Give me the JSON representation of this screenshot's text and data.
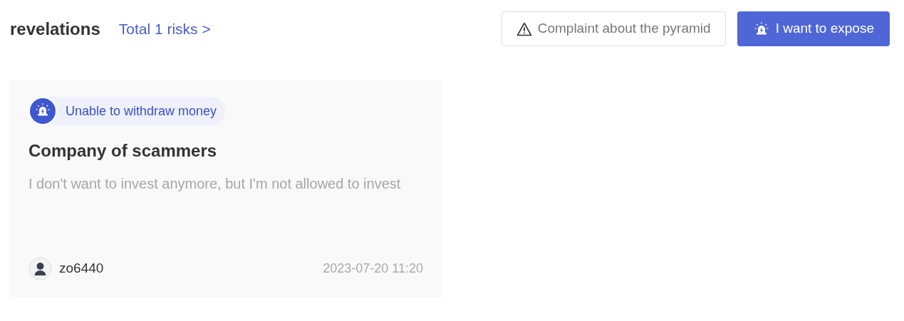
{
  "header": {
    "title": "revelations",
    "total_link": "Total 1 risks >"
  },
  "buttons": [
    {
      "kind": "outline",
      "label": "Complaint about the pyramid"
    },
    {
      "kind": "primary",
      "label": "I want to expose"
    }
  ],
  "cards": [
    {
      "tag": "Unable to withdraw money",
      "title": "Company of scammers",
      "body": "I don't want to invest anymore, but I'm not allowed to invest",
      "user": "zo6440",
      "time": "2023-07-20 11:20"
    }
  ]
}
